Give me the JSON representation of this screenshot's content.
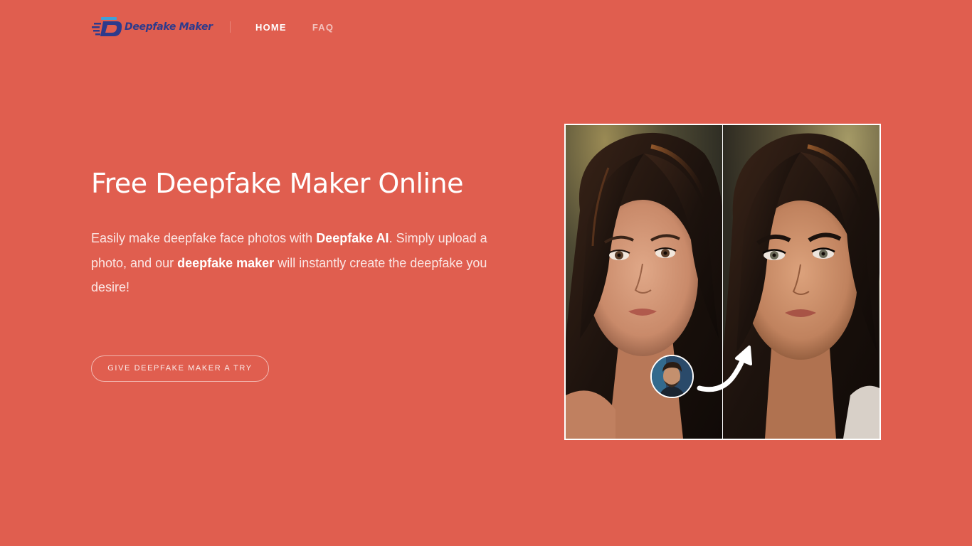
{
  "header": {
    "logo_text": "Deepfake Maker",
    "nav": [
      {
        "label": "HOME",
        "active": true
      },
      {
        "label": "FAQ",
        "active": false
      }
    ]
  },
  "hero": {
    "title": "Free Deepfake Maker Online",
    "description": {
      "part1": "Easily make deepfake face photos with ",
      "bold1": "Deepfake AI",
      "part2": ". Simply upload a photo, and our ",
      "bold2": "deepfake maker",
      "part3": " will instantly create the deepfake you desire!"
    },
    "cta_label": "GIVE DEEPFAKE MAKER A TRY"
  },
  "demo": {
    "icons": [
      "source-face-avatar",
      "curved-arrow-icon"
    ]
  },
  "colors": {
    "background": "#e05e4f",
    "logo_text": "#2d3a8c",
    "logo_accent": "#3fa0d8",
    "text": "#ffffff"
  }
}
